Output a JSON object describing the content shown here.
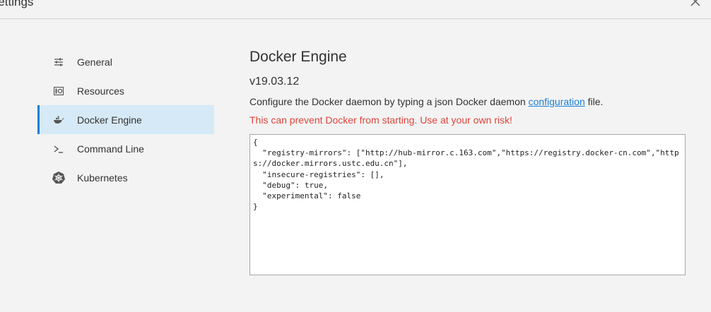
{
  "window": {
    "title": "Settings",
    "close_icon": "close-icon"
  },
  "sidebar": {
    "items": [
      {
        "label": "General",
        "icon": "sliders-icon",
        "active": false
      },
      {
        "label": "Resources",
        "icon": "resources-icon",
        "active": false
      },
      {
        "label": "Docker Engine",
        "icon": "whale-icon",
        "active": true
      },
      {
        "label": "Command Line",
        "icon": "terminal-icon",
        "active": false
      },
      {
        "label": "Kubernetes",
        "icon": "kubernetes-icon",
        "active": false
      }
    ]
  },
  "main": {
    "title": "Docker Engine",
    "version": "v19.03.12",
    "description_prefix": "Configure the Docker daemon by typing a json Docker daemon ",
    "description_link": "configuration",
    "description_suffix": " file.",
    "warning": "This can prevent Docker from starting. Use at your own risk!",
    "config_json": "{\n  \"registry-mirrors\": [\"http://hub-mirror.c.163.com\",\"https://registry.docker-cn.com\",\"https://docker.mirrors.ustc.edu.cn\"],\n  \"insecure-registries\": [],\n  \"debug\": true,\n  \"experimental\": false\n}"
  },
  "colors": {
    "accent": "#1c7fd6",
    "active_bg": "#d6e9f6",
    "warning": "#e0443a",
    "background": "#f3f3f3"
  }
}
